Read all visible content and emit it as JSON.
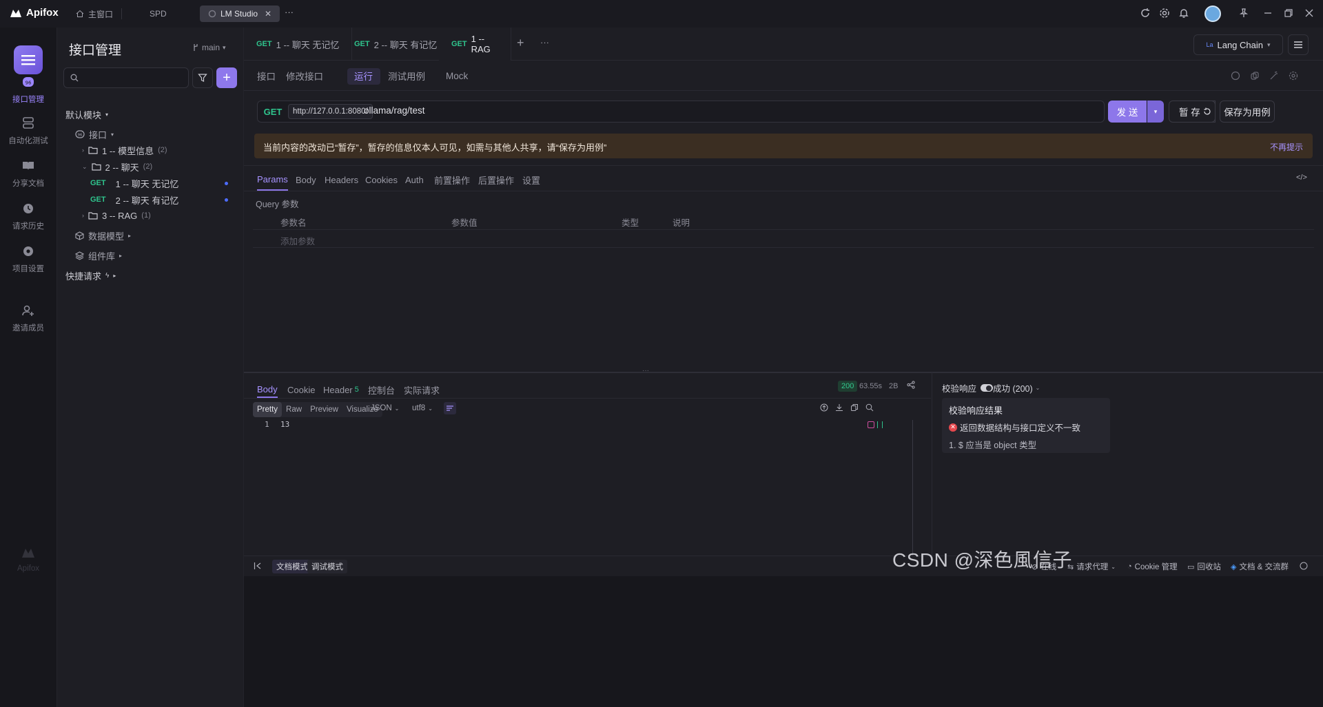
{
  "app": {
    "name": "Apifox"
  },
  "titlebar": {
    "tabs": [
      {
        "label": "主窗口"
      },
      {
        "label": "SPD"
      },
      {
        "label": "LM Studio"
      }
    ],
    "more": "···"
  },
  "nav": {
    "items": [
      {
        "label": "接口管理"
      },
      {
        "label": "自动化测试"
      },
      {
        "label": "分享文档"
      },
      {
        "label": "请求历史"
      },
      {
        "label": "项目设置"
      },
      {
        "label": "邀请成员"
      }
    ],
    "footer_logo": "Apifox"
  },
  "sidebar": {
    "title": "接口管理",
    "branch": "main",
    "search_placeholder": "",
    "default_module": "默认模块",
    "api_root": "接口",
    "tree": [
      {
        "label": "1 -- 模型信息",
        "count": "(2)"
      },
      {
        "label": "2 -- 聊天",
        "count": "(2)"
      },
      {
        "method": "GET",
        "label": "1 -- 聊天 无记忆"
      },
      {
        "method": "GET",
        "label": "2 -- 聊天 有记忆"
      },
      {
        "label": "3 -- RAG",
        "count": "(1)"
      }
    ],
    "data_model": "数据模型",
    "components": "组件库",
    "quick_request": "快捷请求"
  },
  "doc_tabs": [
    {
      "method": "GET",
      "label": "1 -- 聊天 无记忆"
    },
    {
      "method": "GET",
      "label": "2 -- 聊天 有记忆"
    },
    {
      "method": "GET",
      "label": "1 -- RAG"
    }
  ],
  "env": {
    "label": "Lang Chain"
  },
  "subtabs": [
    "接口",
    "修改接口",
    "运行",
    "测试用例",
    "Mock"
  ],
  "request": {
    "method": "GET",
    "host": "http://127.0.0.1:8080/",
    "path": "ollama/rag/test",
    "send": "发 送",
    "save_temp": "暂 存",
    "save_case": "保存为用例"
  },
  "banner": {
    "text": "当前内容的改动已“暂存”，暂存的信息仅本人可见，如需与其他人共享，请“保存为用例”",
    "dismiss": "不再提示"
  },
  "req_tabs": [
    "Params",
    "Body",
    "Headers",
    "Cookies",
    "Auth",
    "前置操作",
    "后置操作",
    "设置"
  ],
  "params": {
    "section": "Query 参数",
    "columns": [
      "参数名",
      "参数值",
      "类型",
      "说明"
    ],
    "add": "添加参数"
  },
  "response": {
    "tabs": [
      "Body",
      "Cookie",
      "Header",
      "控制台",
      "实际请求"
    ],
    "header_count": "5",
    "status": "200",
    "time": "63.55s",
    "size": "2B",
    "formats": [
      "Pretty",
      "Raw",
      "Preview",
      "Visualize"
    ],
    "lang": "JSON",
    "encoding": "utf8",
    "lines": [
      {
        "n": "1",
        "text": "13"
      }
    ]
  },
  "validation": {
    "label": "校验响应",
    "status_sel": "成功 (200)",
    "title": "校验响应结果",
    "error": "返回数据结构与接口定义不一致",
    "detail": "1. $ 应当是 object 类型"
  },
  "bottom": {
    "doc_mode": "文档模式",
    "debug_mode": "调试模式",
    "online": "在线",
    "proxy": "请求代理",
    "cookie": "Cookie 管理",
    "trash": "回收站",
    "docs": "文档 & 交流群"
  },
  "watermark": "CSDN @深色風信子",
  "colors": {
    "accent": "#8d77ea",
    "get": "#2fc48d",
    "banner_bg": "#3b2e22",
    "error": "#e5484d"
  }
}
